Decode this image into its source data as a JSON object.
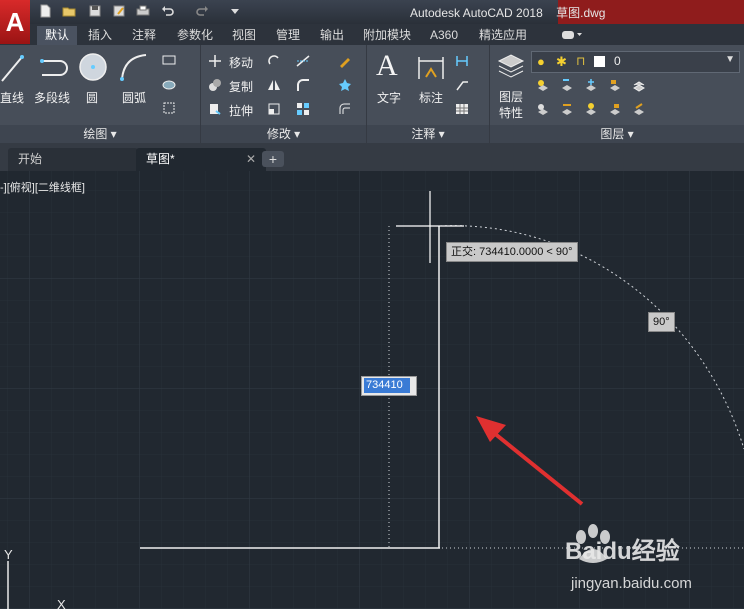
{
  "app": {
    "title": "Autodesk AutoCAD 2018",
    "filename": "草图.dwg",
    "logo_letter": "A"
  },
  "ribbon_tabs": [
    "默认",
    "插入",
    "注释",
    "参数化",
    "视图",
    "管理",
    "输出",
    "附加模块",
    "A360",
    "精选应用"
  ],
  "active_tab": "默认",
  "draw_panel": {
    "title": "绘图",
    "tools": [
      "直线",
      "多段线",
      "圆",
      "圆弧"
    ]
  },
  "modify_panel": {
    "title": "修改",
    "tools": [
      "移动",
      "复制",
      "拉伸"
    ]
  },
  "annotation_panel": {
    "title": "注释",
    "tools": [
      "文字",
      "标注"
    ]
  },
  "layers_panel": {
    "title": "图层",
    "properties_label": [
      "图层",
      "特性"
    ],
    "current_layer": "0"
  },
  "file_tabs": {
    "start": "开始",
    "drawing": "草图*"
  },
  "viewport": {
    "label": "-][俯视][二维线框]",
    "tooltip_ortho": "正交: 734410.0000 < 90°",
    "angle_tooltip": "90°",
    "dynamic_input_value": "734410",
    "ucs_y": "Y",
    "ucs_x": "X"
  },
  "watermark": {
    "brand": "Baidu经验",
    "url": "jingyan.baidu.com"
  },
  "colors": {
    "canvas_bg": "#212830",
    "ribbon_bg": "#474e59",
    "title_red": "#8f1c1c",
    "arrow_red": "#e03030"
  }
}
